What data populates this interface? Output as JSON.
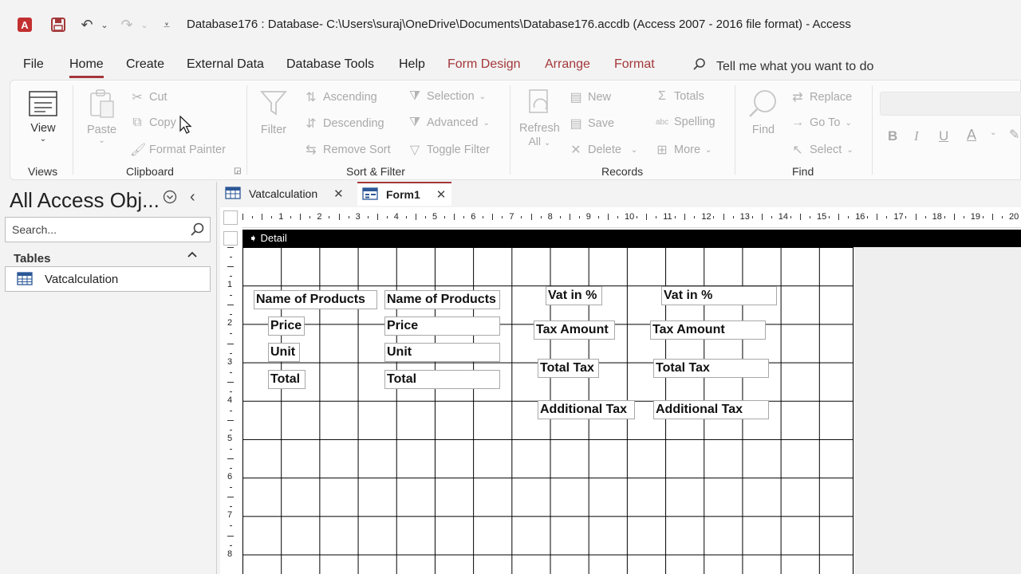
{
  "titlebar": {
    "title": "Database176 : Database- C:\\Users\\suraj\\OneDrive\\Documents\\Database176.accdb (Access 2007 - 2016 file format)  -  Access",
    "app_icon_letter": "A"
  },
  "menu": {
    "tabs": [
      "File",
      "Home",
      "Create",
      "External Data",
      "Database Tools",
      "Help",
      "Form Design",
      "Arrange",
      "Format"
    ],
    "active": "Home",
    "tellme": "Tell me what you want to do"
  },
  "ribbon": {
    "views": {
      "view_label": "View",
      "group": "Views"
    },
    "clipboard": {
      "paste": "Paste",
      "cut": "Cut",
      "copy": "Copy",
      "format_painter": "Format Painter",
      "group": "Clipboard"
    },
    "sort_filter": {
      "filter": "Filter",
      "ascending": "Ascending",
      "descending": "Descending",
      "remove_sort": "Remove Sort",
      "selection": "Selection",
      "advanced": "Advanced",
      "toggle_filter": "Toggle Filter",
      "group": "Sort & Filter"
    },
    "records": {
      "refresh": "Refresh",
      "refresh_all": "All",
      "new": "New",
      "save": "Save",
      "delete": "Delete",
      "totals": "Totals",
      "spelling": "Spelling",
      "more": "More",
      "group": "Records"
    },
    "find": {
      "find": "Find",
      "replace": "Replace",
      "goto": "Go To",
      "select": "Select",
      "group": "Find"
    },
    "format": {
      "bold": "B",
      "italic": "I",
      "underline": "U",
      "font_color": "A"
    }
  },
  "nav": {
    "title": "All Access Obj...",
    "search_placeholder": "Search...",
    "section": "Tables",
    "items": [
      "Vatcalculation"
    ]
  },
  "doctabs": [
    {
      "label": "Vatcalculation",
      "active": false
    },
    {
      "label": "Form1",
      "active": true
    }
  ],
  "design": {
    "section_label": "Detail",
    "ruler_numbers": [
      "1",
      "2",
      "3",
      "4",
      "5",
      "6",
      "7",
      "8",
      "9",
      "10",
      "11",
      "12",
      "13",
      "14",
      "15",
      "16",
      "17",
      "18",
      "19",
      "20"
    ],
    "vruler_numbers": [
      "1",
      "2",
      "3",
      "4",
      "5",
      "6",
      "7",
      "8"
    ],
    "controls": {
      "lbl_name": "Name of Products",
      "txt_name": "Name of Products",
      "lbl_price": "Price",
      "txt_price": "Price",
      "lbl_unit": "Unit",
      "txt_unit": "Unit",
      "lbl_total": "Total",
      "txt_total": "Total",
      "lbl_vat": "Vat in %",
      "txt_vat": "Vat in %",
      "lbl_tax_amount": "Tax Amount",
      "txt_tax_amount": "Tax Amount",
      "lbl_total_tax": "Total Tax",
      "txt_total_tax": "Total Tax",
      "lbl_additional_tax": "Additional Tax",
      "txt_additional_tax": "Additional Tax"
    }
  }
}
